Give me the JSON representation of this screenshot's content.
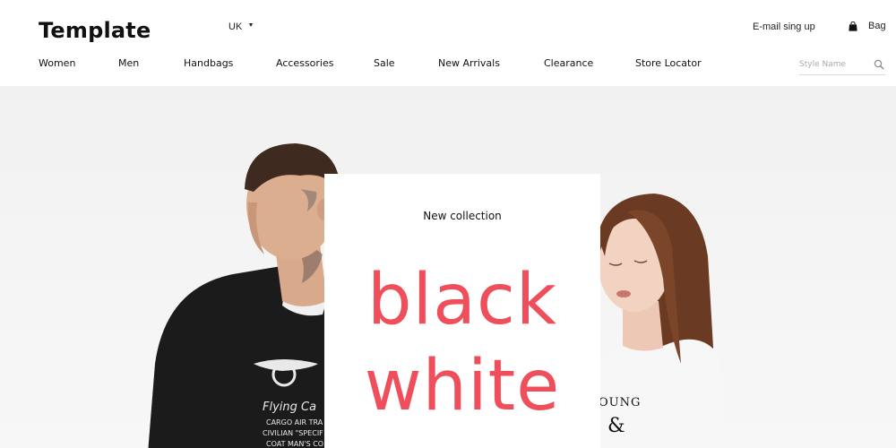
{
  "header": {
    "logo": "Template",
    "locale": "UK",
    "signup": "E-mail sing up",
    "bag_label": "Bag"
  },
  "nav": {
    "items": [
      {
        "label": "Women"
      },
      {
        "label": "Men"
      },
      {
        "label": "Handbags"
      },
      {
        "label": "Accessories"
      },
      {
        "label": "Sale"
      },
      {
        "label": "New Arrivals"
      },
      {
        "label": "Clearance"
      },
      {
        "label": "Store Locator"
      }
    ]
  },
  "search": {
    "placeholder": "Style Name"
  },
  "hero": {
    "eyebrow": "New collection",
    "line1": "black",
    "line2": "white",
    "man_shirt_text": [
      "Flying Ca",
      "CARGO AIR TRA",
      "CIVILIAN \"SPECIF",
      "COAT MAN'S CO"
    ],
    "woman_shirt_text": [
      "OUNG",
      "&"
    ]
  },
  "colors": {
    "accent": "#ef4f5a",
    "text": "#111111",
    "background": "#f3f3f3"
  },
  "icons": {
    "bag": "shopping-bag-icon",
    "search": "search-icon",
    "caret": "caret-down-icon"
  }
}
